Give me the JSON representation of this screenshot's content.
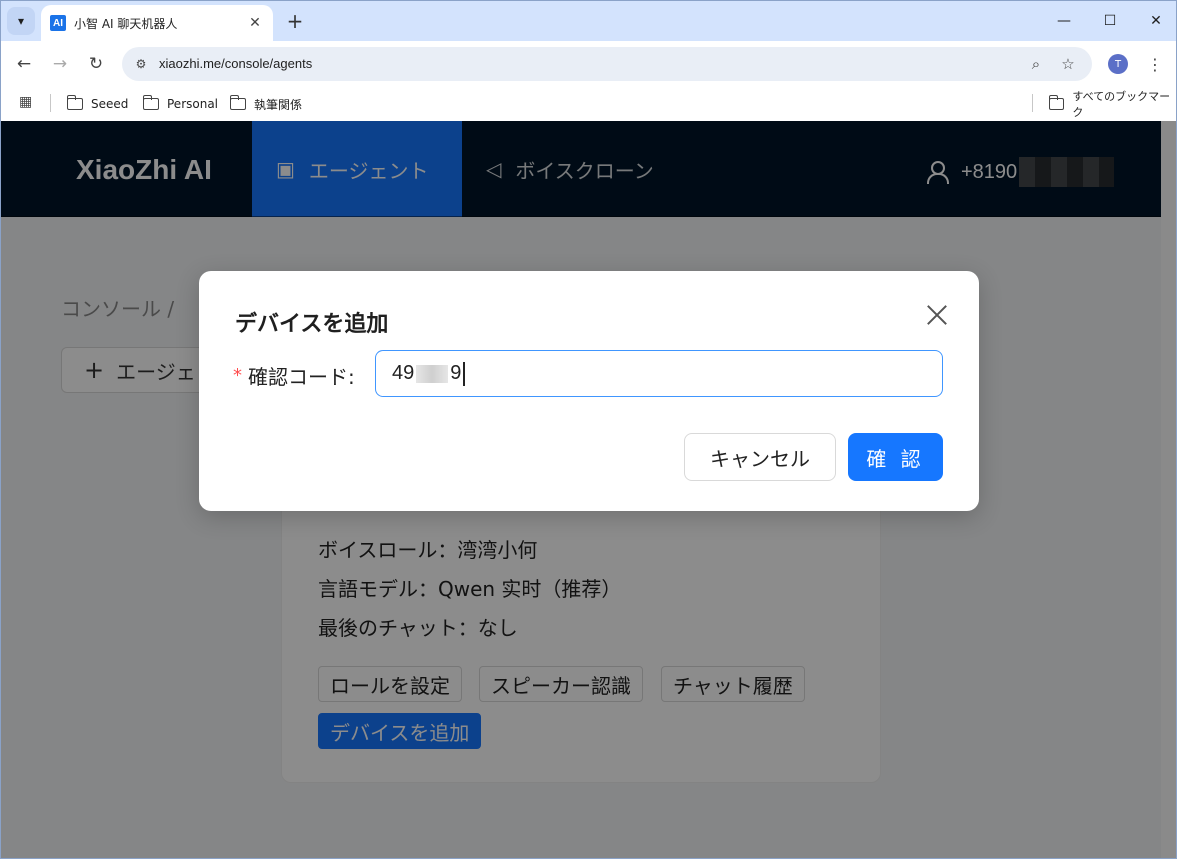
{
  "browser": {
    "tab_title": "小智 AI 聊天机器人",
    "tab_favicon": "AI",
    "url": "xiaozhi.me/console/agents",
    "profile_initial": "T",
    "bookmarks": [
      "Seeed",
      "Personal",
      "執筆関係"
    ],
    "all_bookmarks": "すべてのブックマーク"
  },
  "header": {
    "brand": "XiaoZhi AI",
    "nav": [
      "エージェント",
      "ボイスクローン"
    ],
    "user_phone": "+8190"
  },
  "page": {
    "breadcrumb": "コンソール  /",
    "create_label": "エージェ",
    "card": {
      "voice_role": "ボイスロール：湾湾小何",
      "language_model": "言語モデル：Qwen 实时（推荐）",
      "last_chat": "最後のチャット：なし",
      "buttons": [
        "ロールを設定",
        "スピーカー認識",
        "チャット履歴",
        "デバイスを追加"
      ]
    }
  },
  "dialog": {
    "title": "デバイスを追加",
    "label": "確認コード:",
    "value_prefix": "49",
    "value_suffix": "9",
    "cancel": "キャンセル",
    "ok": "確 認"
  },
  "colors": {
    "primary": "#1677ff",
    "header_bg": "#001529",
    "required": "#ff4d4f"
  }
}
